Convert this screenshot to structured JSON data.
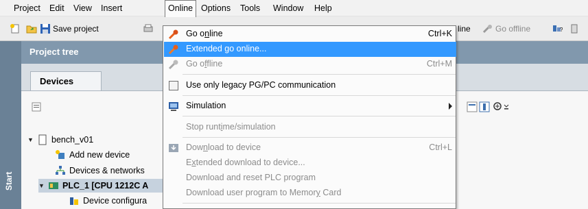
{
  "menubar": {
    "items": [
      {
        "label": "Project"
      },
      {
        "label": "Edit"
      },
      {
        "label": "View"
      },
      {
        "label": "Insert"
      },
      {
        "label": "Online"
      },
      {
        "label": "Options"
      },
      {
        "label": "Tools"
      },
      {
        "label": "Window"
      },
      {
        "label": "Help"
      }
    ]
  },
  "toolbar": {
    "save_label": "Save project",
    "go_online_partial": "line",
    "go_offline_label": "Go offline"
  },
  "sidebar": {
    "start_label": "Start"
  },
  "project_tree": {
    "title": "Project tree",
    "tab": "Devices",
    "items": [
      {
        "label": "bench_v01"
      },
      {
        "label": "Add new device"
      },
      {
        "label": "Devices & networks"
      },
      {
        "label": "PLC_1 [CPU 1212C A"
      },
      {
        "label": "Device configura"
      }
    ]
  },
  "online_menu": {
    "items": [
      {
        "pre": "Go o",
        "ul": "n",
        "post": "line",
        "shortcut": "Ctrl+K"
      },
      {
        "label": "Extended go online..."
      },
      {
        "pre": "Go o",
        "ul": "f",
        "post": "fline",
        "shortcut": "Ctrl+M"
      },
      {
        "label": "Use only legacy PG/PC communication"
      },
      {
        "label": "Simulation"
      },
      {
        "pre": "Stop runt",
        "ul": "i",
        "post": "me/simulation"
      },
      {
        "pre": "Dow",
        "ul": "n",
        "post": "load to device",
        "shortcut": "Ctrl+L"
      },
      {
        "pre": "E",
        "ul": "x",
        "post": "tended download to device..."
      },
      {
        "label": "Download and reset PLC program"
      },
      {
        "pre": "Download user program to Memor",
        "ul": "y",
        "post": " Card"
      }
    ]
  },
  "colors": {
    "highlight": "#3399ff",
    "header": "#8198ad",
    "start_strip": "#6a8196"
  }
}
